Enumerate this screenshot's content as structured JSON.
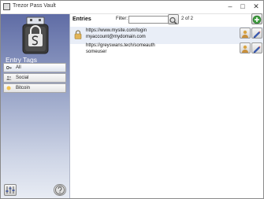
{
  "window": {
    "title": "Trezor Pass Vault",
    "controls": {
      "minimize": "–",
      "maximize": "□",
      "close": "✕"
    }
  },
  "sidebar": {
    "logo_icon": "usb-key-padlock-icon",
    "entry_tags_label": "Entry Tags",
    "tags": [
      {
        "label": "All",
        "icon": "key-icon",
        "selected": true
      },
      {
        "label": "Social",
        "icon": "people-icon",
        "selected": false
      },
      {
        "label": "Bitcoin",
        "icon": "bitcoin-icon",
        "selected": false
      }
    ],
    "settings_icon": "sliders-icon",
    "help_icon": "question-mark-icon"
  },
  "main": {
    "entries_label": "Entries",
    "filter_label": "Filter:",
    "filter_value": "",
    "count_text": "2 of 2",
    "search_icon": "magnifier-icon",
    "add_icon": "plus-icon",
    "entries": [
      {
        "url": "https://www.mysite.com/login",
        "username": "myaccount@mydomain.com",
        "locked": true,
        "selected": true
      },
      {
        "url": "https://greyswans.tech/someauth",
        "username": "someuser",
        "locked": false,
        "selected": false
      }
    ],
    "entry_actions": {
      "show_icon": "face-show-icon",
      "edit_icon": "pencil-icon"
    }
  },
  "colors": {
    "sidebar_top": "#5f6ca5",
    "sidebar_bottom": "#e8ecf4",
    "accent_green": "#3c9a3c",
    "selected_row": "#e9eef7"
  }
}
